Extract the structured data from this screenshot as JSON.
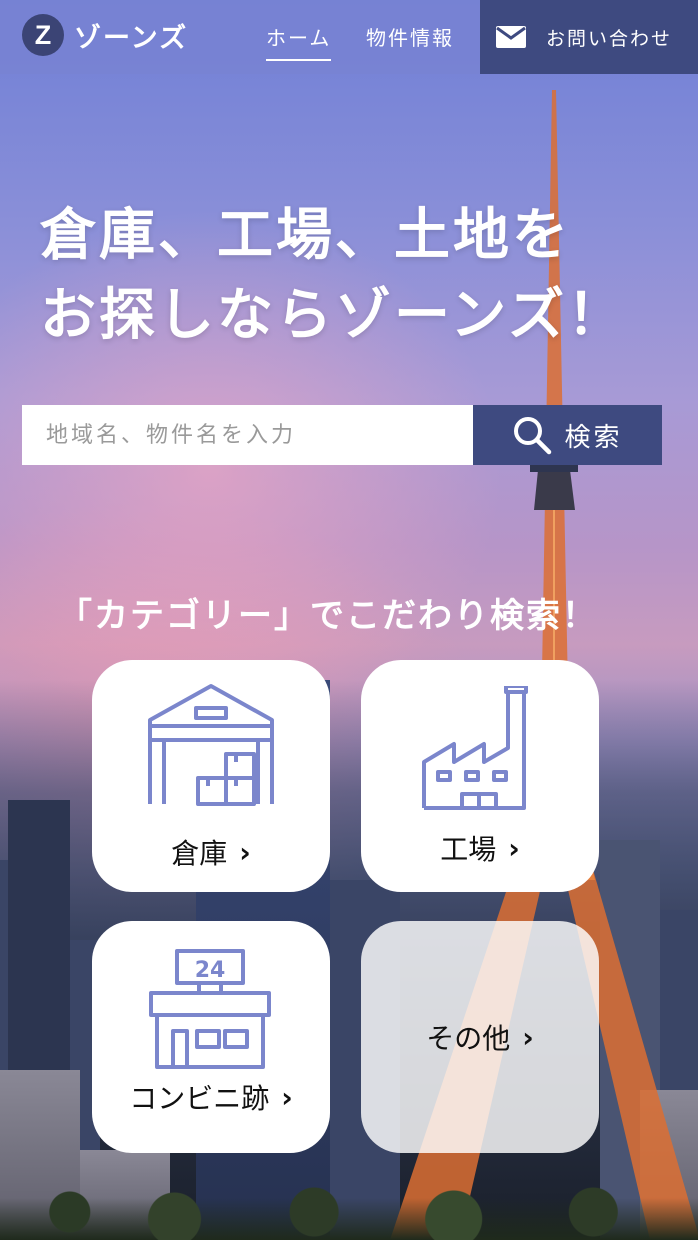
{
  "header": {
    "logo_mark": "Z",
    "logo_text": "ゾーンズ",
    "nav": [
      {
        "label": "ホーム",
        "active": true
      },
      {
        "label": "物件情報",
        "active": false
      }
    ],
    "contact_label": "お問い合わせ",
    "contact_icon": "mail-icon"
  },
  "hero": {
    "title_line1": "倉庫、工場、土地を",
    "title_line2": "お探しならゾーンズ！"
  },
  "search": {
    "placeholder": "地域名、物件名を入力",
    "value": "",
    "button_label": "検索",
    "button_icon": "search-icon"
  },
  "categories": {
    "heading": "「カテゴリー」でこだわり検索！",
    "items": [
      {
        "label": "倉庫",
        "icon": "warehouse-icon"
      },
      {
        "label": "工場",
        "icon": "factory-icon"
      },
      {
        "label": "コンビニ跡",
        "icon": "convenience-store-icon",
        "sign_text": "24"
      },
      {
        "label": "その他",
        "icon": ""
      }
    ]
  },
  "colors": {
    "header_bg": "#7882d2",
    "accent": "#3e4a80",
    "icon_stroke": "#7b86cc"
  }
}
